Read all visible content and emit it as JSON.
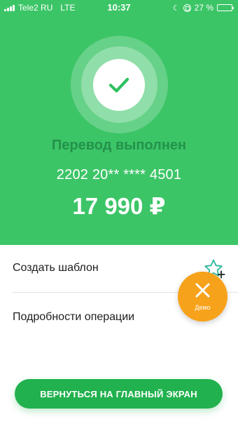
{
  "status_bar": {
    "carrier": "Tele2 RU",
    "network": "LTE",
    "time": "10:37",
    "battery": "27 %",
    "battery_level": 0.27
  },
  "transfer": {
    "title": "Перевод выполнен",
    "card_number": "2202 20** **** 4501",
    "amount": "17 990 ₽"
  },
  "actions": {
    "create_template": "Создать шаблон",
    "operation_details": "Подробности операции"
  },
  "demo": {
    "label": "Демо"
  },
  "main_button": {
    "label": "ВЕРНУТЬСЯ НА ГЛАВНЫЙ ЭКРАН"
  },
  "colors": {
    "hero_green": "#3cc567",
    "title_green": "#23924a",
    "button_green": "#21b14e",
    "demo_orange": "#f7a21b",
    "star_teal": "#2bb79c"
  },
  "icons": {
    "success": "check-icon",
    "template": "star-plus-icon",
    "demo_close": "close-icon"
  }
}
